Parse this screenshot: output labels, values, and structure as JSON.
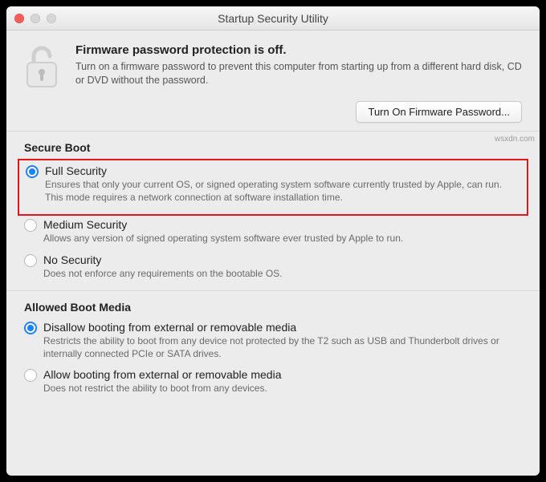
{
  "window": {
    "title": "Startup Security Utility"
  },
  "firmware": {
    "heading": "Firmware password protection is off.",
    "description": "Turn on a firmware password to prevent this computer from starting up from a different hard disk, CD or DVD without the password.",
    "button_label": "Turn On Firmware Password..."
  },
  "secure_boot": {
    "section_title": "Secure Boot",
    "options": {
      "full": {
        "label": "Full Security",
        "desc": "Ensures that only your current OS, or signed operating system software currently trusted by Apple, can run. This mode requires a network connection at software installation time.",
        "selected": true
      },
      "medium": {
        "label": "Medium Security",
        "desc": "Allows any version of signed operating system software ever trusted by Apple to run.",
        "selected": false
      },
      "none": {
        "label": "No Security",
        "desc": "Does not enforce any requirements on the bootable OS.",
        "selected": false
      }
    }
  },
  "allowed_boot": {
    "section_title": "Allowed Boot Media",
    "options": {
      "disallow": {
        "label": "Disallow booting from external or removable media",
        "desc": "Restricts the ability to boot from any device not protected by the T2 such as USB and Thunderbolt drives or internally connected PCIe or SATA drives.",
        "selected": true
      },
      "allow": {
        "label": "Allow booting from external or removable media",
        "desc": "Does not restrict the ability to boot from any devices.",
        "selected": false
      }
    }
  },
  "watermark": "wsxdn.com"
}
